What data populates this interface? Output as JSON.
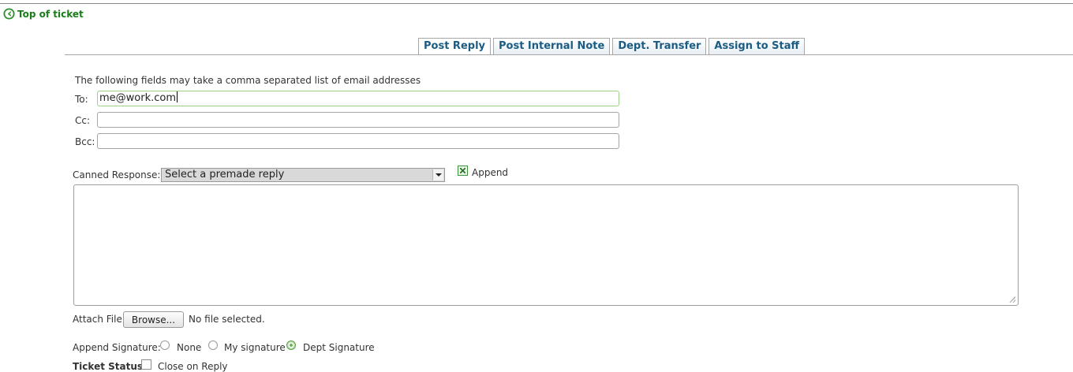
{
  "header": {
    "top_link_label": "Top of ticket"
  },
  "tabs": [
    {
      "label": "Post Reply",
      "active": true
    },
    {
      "label": "Post Internal Note",
      "active": false
    },
    {
      "label": "Dept. Transfer",
      "active": false
    },
    {
      "label": "Assign to Staff",
      "active": false
    }
  ],
  "form": {
    "intro": "The following fields may take a comma separated list of email addresses",
    "to_label": "To:",
    "to_value": "me@work.com",
    "cc_label": "Cc:",
    "cc_value": "",
    "bcc_label": "Bcc:",
    "bcc_value": "",
    "canned_label": "Canned Response:",
    "canned_selected": "Select a premade reply",
    "append_label": "Append",
    "append_checked": true,
    "response_value": "",
    "attach_label": "Attach File:",
    "browse_label": "Browse...",
    "no_file_label": "No file selected.",
    "signature_label": "Append Signature:",
    "signature_options": [
      {
        "label": "None",
        "checked": false
      },
      {
        "label": "My signature",
        "checked": false
      },
      {
        "label": "Dept Signature",
        "checked": true
      }
    ],
    "status_label": "Ticket Status:",
    "close_label": "Close on Reply",
    "close_checked": false
  },
  "colors": {
    "link_green": "#1a7d1a",
    "tab_blue": "#1a5c84",
    "focus_green": "#9fd08a"
  },
  "icons": {
    "top_link": "circle-arrow-left-icon",
    "append": "checkbox-x-icon"
  }
}
